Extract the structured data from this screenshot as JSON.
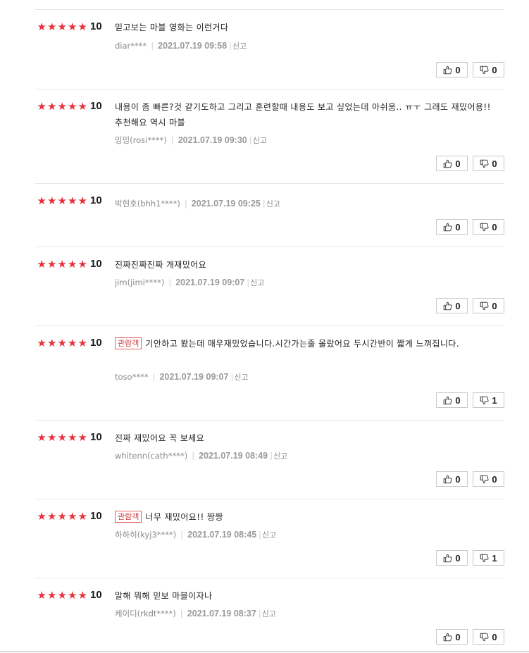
{
  "reviews": [
    {
      "score": "10",
      "badge": "",
      "text": "믿고보는 마블 영화는 이런거다",
      "user": "diar****",
      "date": "2021.07.19 09:58",
      "report": "신고",
      "likes": "0",
      "dislikes": "0"
    },
    {
      "score": "10",
      "badge": "",
      "text": "내용이 좀 빠른?것 같기도하고 그리고 훈련할때 내용도 보고 싶었는데 아쉬움.. ㅠㅜ 그래도 재밌어용!! 추천해요 역시 마블",
      "user": "밍밍(rosi****)",
      "date": "2021.07.19 09:30",
      "report": "신고",
      "likes": "0",
      "dislikes": "0"
    },
    {
      "score": "10",
      "badge": "",
      "text": "",
      "user": "박현호(bhh1****)",
      "date": "2021.07.19 09:25",
      "report": "신고",
      "likes": "0",
      "dislikes": "0"
    },
    {
      "score": "10",
      "badge": "",
      "text": "진짜진짜진짜 개재밌어요",
      "user": "jim(jimi****)",
      "date": "2021.07.19 09:07",
      "report": "신고",
      "likes": "0",
      "dislikes": "0"
    },
    {
      "score": "10",
      "badge": "관람객",
      "text": "기안하고 봤는데 매우재밌었습니다.시간가는줄 몰랐어요 두시간반이 짧게 느껴집니다.",
      "user": "toso****",
      "date": "2021.07.19 09:07",
      "report": "신고",
      "likes": "0",
      "dislikes": "1"
    },
    {
      "score": "10",
      "badge": "",
      "text": "진짜 재밌어요 꼭 보세요",
      "user": "whitenn(cath****)",
      "date": "2021.07.19 08:49",
      "report": "신고",
      "likes": "0",
      "dislikes": "0"
    },
    {
      "score": "10",
      "badge": "관람객",
      "text": "너무 재밌어요!! 짱짱",
      "user": "하하히(kyj3****)",
      "date": "2021.07.19 08:45",
      "report": "신고",
      "likes": "0",
      "dislikes": "1"
    },
    {
      "score": "10",
      "badge": "",
      "text": "말해 뭐해 믿보 마블이자나",
      "user": "케이디(rkdt****)",
      "date": "2021.07.19 08:37",
      "report": "신고",
      "likes": "0",
      "dislikes": "0"
    }
  ],
  "icons": {
    "star": "filled-star-icon",
    "like": "thumbs-up-icon",
    "dislike": "thumbs-down-icon"
  },
  "colors": {
    "star": "#e8313b",
    "badge_border": "#e0605f",
    "badge_text": "#d23b3a"
  }
}
